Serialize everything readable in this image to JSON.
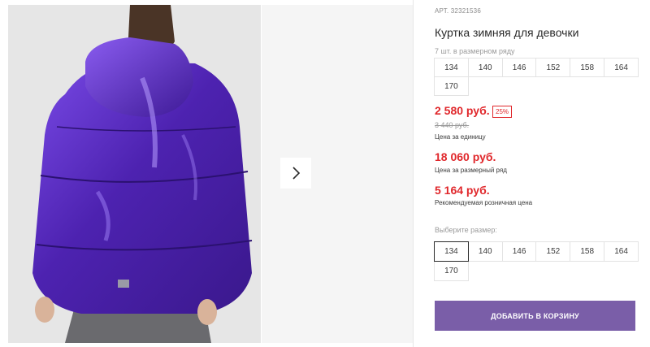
{
  "product": {
    "sku_label": "АРТ.",
    "sku": "32321536",
    "title": "Куртка зимняя для девочки",
    "per_row_note": "7 шт. в размерном ряду",
    "row_sizes": [
      "134",
      "140",
      "146",
      "152",
      "158",
      "164",
      "170"
    ],
    "price": "2 580 руб.",
    "discount": "25%",
    "old_price": "3 440 руб.",
    "unit_label": "Цена за единицу",
    "row_price": "18 060 руб.",
    "row_price_label": "Цена за размерный ряд",
    "retail_price": "5 164 руб.",
    "retail_price_label": "Рекомендуемая розничная цена"
  },
  "size_picker": {
    "label": "Выберите размер:",
    "sizes": [
      "134",
      "140",
      "146",
      "152",
      "158",
      "164",
      "170"
    ],
    "selected": "134"
  },
  "cart": {
    "add_label": "ДОБАВИТЬ В КОРЗИНУ"
  },
  "gallery": {
    "next_icon": "chevron-right-icon",
    "colors": {
      "jacket": "#5a2fc0",
      "accent": "#7a5ea8",
      "price_red": "#e0272b"
    }
  }
}
